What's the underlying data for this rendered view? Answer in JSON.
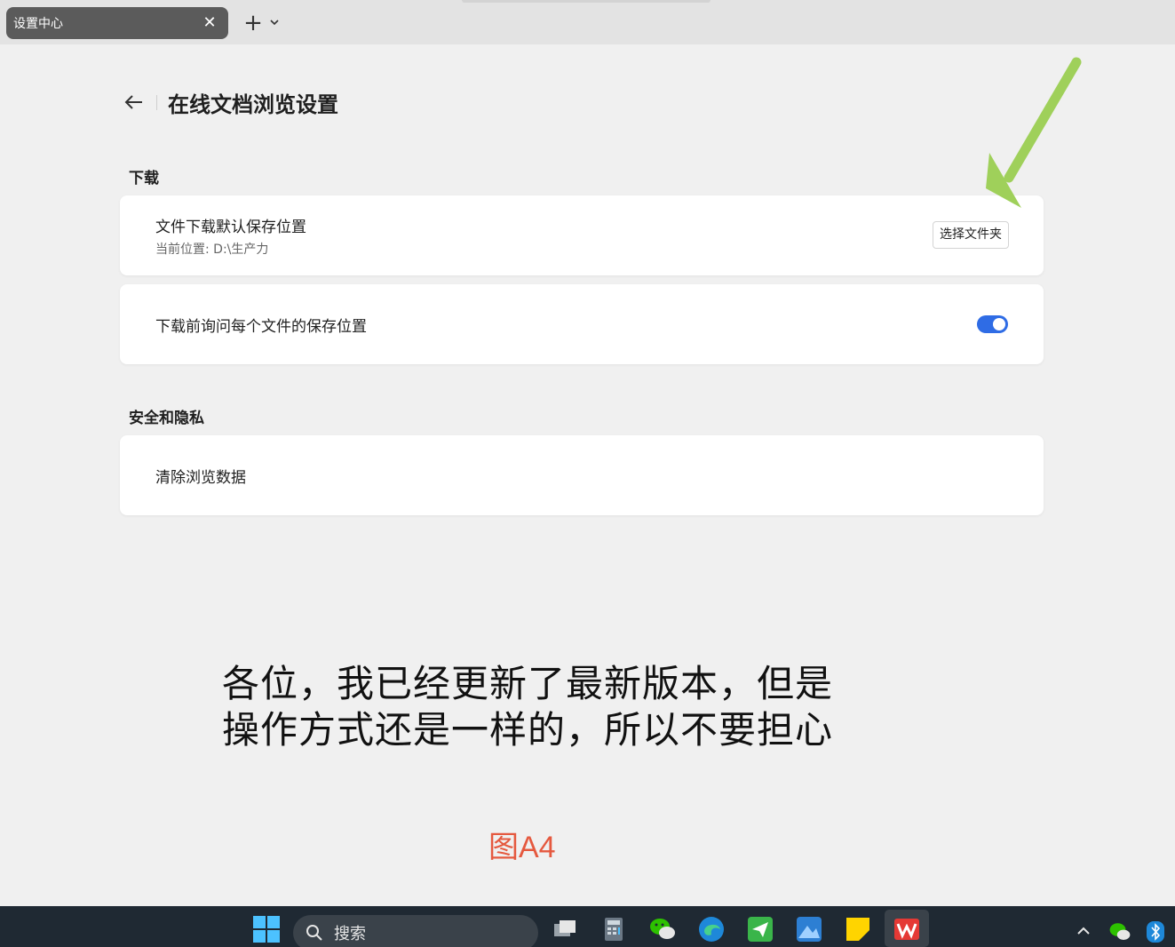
{
  "tab": {
    "title": "设置中心",
    "close_glyph": "✕",
    "new_glyph": "+"
  },
  "header": {
    "title": "在线文档浏览设置"
  },
  "sections": [
    {
      "title": "下载",
      "items": [
        {
          "label": "文件下载默认保存位置",
          "sub": "当前位置: D:\\生产力",
          "button": "选择文件夹"
        },
        {
          "label": "下载前询问每个文件的保存位置",
          "toggle_on": true
        }
      ]
    },
    {
      "title": "安全和隐私",
      "items": [
        {
          "label": "清除浏览数据"
        }
      ]
    }
  ],
  "caption": {
    "line1": "各位，我已经更新了最新版本，但是",
    "line2": "操作方式还是一样的，所以不要担心"
  },
  "figure_label": "图A4",
  "taskbar": {
    "search_text": "搜索",
    "icons": [
      "windows-start-icon",
      "search-icon",
      "task-view-icon",
      "calculator-icon",
      "wechat-icon",
      "edge-icon",
      "send-icon",
      "photos-icon",
      "sticky-notes-icon",
      "wps-icon",
      "chevron-up-icon",
      "wechat-tray-icon",
      "bluetooth-icon"
    ]
  },
  "colors": {
    "accent": "#2f6ce5",
    "arrow": "#9fd05a",
    "figure_label": "#e5593f"
  }
}
